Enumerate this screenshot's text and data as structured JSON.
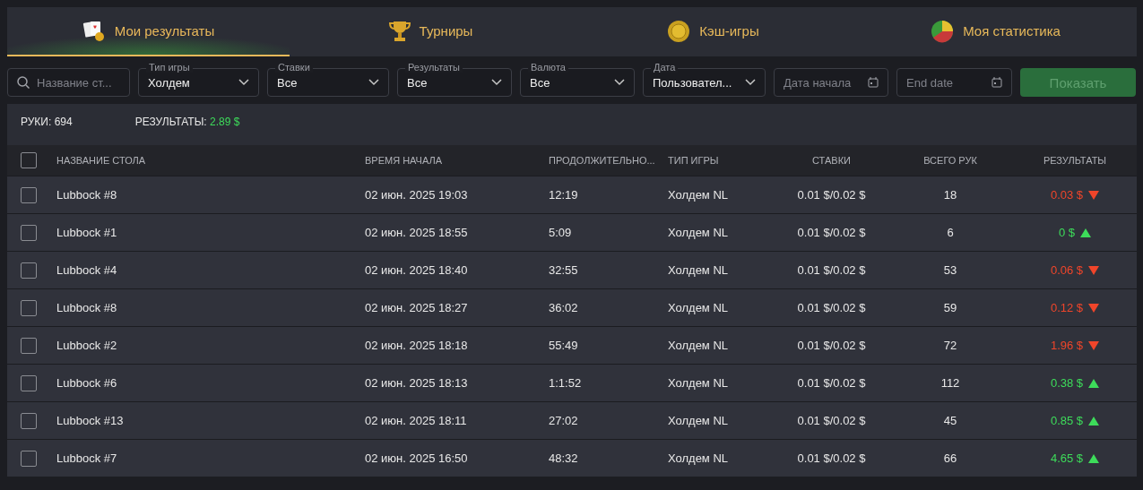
{
  "tabs": [
    {
      "label": "Мои результаты",
      "selected": true
    },
    {
      "label": "Турниры",
      "selected": false
    },
    {
      "label": "Кэш-игры",
      "selected": false
    },
    {
      "label": "Моя статистика",
      "selected": false
    }
  ],
  "filters": [
    {
      "kind": "search",
      "placeholder": "Название ст..."
    },
    {
      "kind": "select",
      "label": "Тип игры",
      "value": "Холдем"
    },
    {
      "kind": "select",
      "label": "Ставки",
      "value": "Все"
    },
    {
      "kind": "select",
      "label": "Результаты",
      "value": "Все"
    },
    {
      "kind": "select",
      "label": "Валюта",
      "value": "Все"
    },
    {
      "kind": "select",
      "label": "Дата",
      "value": "Пользовател..."
    },
    {
      "kind": "date",
      "placeholder": "Дата начала"
    },
    {
      "kind": "date",
      "placeholder": "End date"
    }
  ],
  "show_button": {
    "label": "Показать",
    "disabled": true
  },
  "summary": {
    "hands_label": "РУКИ:",
    "hands": "694",
    "results_label": "РЕЗУЛЬТАТЫ:",
    "results": "2.89 $"
  },
  "table": {
    "select_all_checked": false,
    "columns": [
      "НАЗВАНИЕ СТОЛА",
      "ВРЕМЯ НАЧАЛА",
      "ПРОДОЛЖИТЕЛЬНО...",
      "ТИП ИГРЫ",
      "СТАВКИ",
      "ВСЕГО РУК",
      "РЕЗУЛЬТАТЫ"
    ],
    "rows": [
      {
        "checked": false,
        "cells": [
          "Lubbock #8",
          "02 июн. 2025 19:03",
          "12:19",
          "Холдем NL",
          "0.01 $/0.02 $",
          "18"
        ],
        "result": "0.03 $",
        "kind": "down"
      },
      {
        "checked": false,
        "cells": [
          "Lubbock #1",
          "02 июн. 2025 18:55",
          "5:09",
          "Холдем NL",
          "0.01 $/0.02 $",
          "6"
        ],
        "result": "0 $",
        "kind": "up"
      },
      {
        "checked": false,
        "cells": [
          "Lubbock #4",
          "02 июн. 2025 18:40",
          "32:55",
          "Холдем NL",
          "0.01 $/0.02 $",
          "53"
        ],
        "result": "0.06 $",
        "kind": "down"
      },
      {
        "checked": false,
        "cells": [
          "Lubbock #8",
          "02 июн. 2025 18:27",
          "36:02",
          "Холдем NL",
          "0.01 $/0.02 $",
          "59"
        ],
        "result": "0.12 $",
        "kind": "down"
      },
      {
        "checked": false,
        "cells": [
          "Lubbock #2",
          "02 июн. 2025 18:18",
          "55:49",
          "Холдем NL",
          "0.01 $/0.02 $",
          "72"
        ],
        "result": "1.96 $",
        "kind": "down"
      },
      {
        "checked": false,
        "cells": [
          "Lubbock #6",
          "02 июн. 2025 18:13",
          "1:1:52",
          "Холдем NL",
          "0.01 $/0.02 $",
          "112"
        ],
        "result": "0.38 $",
        "kind": "up"
      },
      {
        "checked": false,
        "cells": [
          "Lubbock #13",
          "02 июн. 2025 18:11",
          "27:02",
          "Холдем NL",
          "0.01 $/0.02 $",
          "45"
        ],
        "result": "0.85 $",
        "kind": "up"
      },
      {
        "checked": false,
        "cells": [
          "Lubbock #7",
          "02 июн. 2025 16:50",
          "48:32",
          "Холдем NL",
          "0.01 $/0.02 $",
          "66"
        ],
        "result": "4.65 $",
        "kind": "up"
      }
    ]
  }
}
